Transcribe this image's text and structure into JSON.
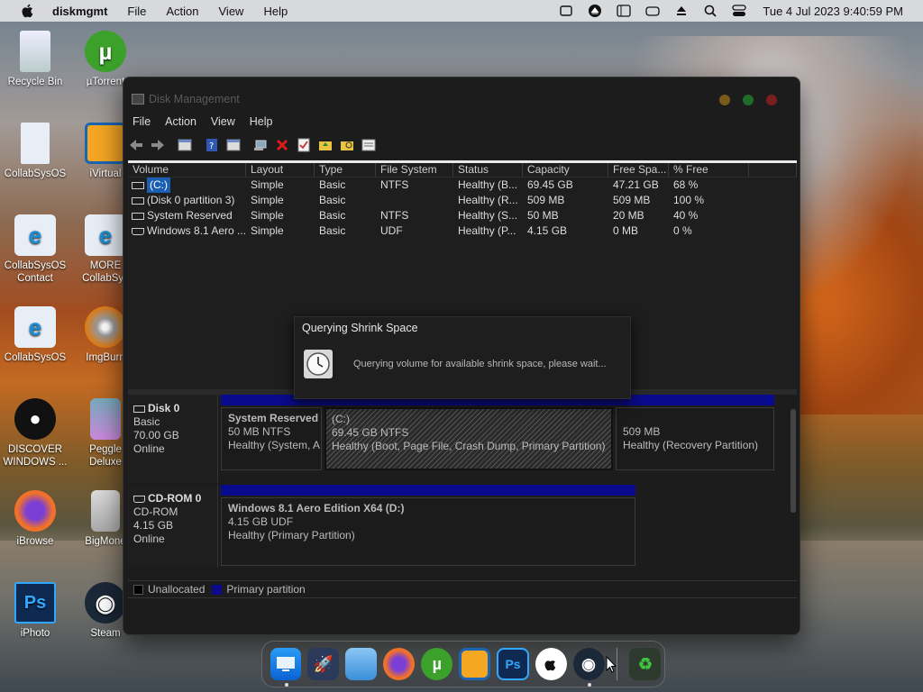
{
  "menubar": {
    "app_name": "diskmgmt",
    "items": [
      "File",
      "Action",
      "View",
      "Help"
    ],
    "clock": "Tue 4 Jul 2023  9:40:59 PM"
  },
  "desktop_icons": [
    {
      "label": "Recycle Bin",
      "icon": "recycle-bin-icon"
    },
    {
      "label": "µTorrent",
      "icon": "utorrent-icon"
    },
    {
      "label": "CollabSysOS",
      "icon": "document-icon"
    },
    {
      "label": "iVirtual",
      "icon": "virtualbox-icon"
    },
    {
      "label": "CollabSysOS\nContact",
      "icon": "ie-icon"
    },
    {
      "label": "MORE\nCollabSys",
      "icon": "ie-icon"
    },
    {
      "label": "CollabSysOS",
      "icon": "ie-icon"
    },
    {
      "label": "ImgBurn",
      "icon": "imgburn-icon"
    },
    {
      "label": "DISCOVER\nWINDOWS ...",
      "icon": "apple-icon"
    },
    {
      "label": "Peggle\nDeluxe",
      "icon": "peggle-icon"
    },
    {
      "label": "iBrowse",
      "icon": "firefox-icon"
    },
    {
      "label": "BigMone",
      "icon": "bigmoney-icon"
    },
    {
      "label": "iPhoto",
      "icon": "photoshop-icon"
    },
    {
      "label": "Steam",
      "icon": "steam-icon"
    }
  ],
  "window": {
    "title": "Disk Management",
    "menu": [
      "File",
      "Action",
      "View",
      "Help"
    ],
    "columns": [
      "Volume",
      "Layout",
      "Type",
      "File System",
      "Status",
      "Capacity",
      "Free Spa...",
      "% Free"
    ],
    "volumes": [
      {
        "volume": "(C:)",
        "layout": "Simple",
        "type": "Basic",
        "fs": "NTFS",
        "status": "Healthy (B...",
        "capacity": "69.45 GB",
        "free": "47.21 GB",
        "pct": "68 %"
      },
      {
        "volume": "(Disk 0 partition 3)",
        "layout": "Simple",
        "type": "Basic",
        "fs": "",
        "status": "Healthy (R...",
        "capacity": "509 MB",
        "free": "509 MB",
        "pct": "100 %"
      },
      {
        "volume": "System Reserved",
        "layout": "Simple",
        "type": "Basic",
        "fs": "NTFS",
        "status": "Healthy (S...",
        "capacity": "50 MB",
        "free": "20 MB",
        "pct": "40 %"
      },
      {
        "volume": "Windows 8.1 Aero ...",
        "layout": "Simple",
        "type": "Basic",
        "fs": "UDF",
        "status": "Healthy (P...",
        "capacity": "4.15 GB",
        "free": "0 MB",
        "pct": "0 %"
      }
    ],
    "dialog": {
      "title": "Querying Shrink Space",
      "message": "Querying volume for available shrink space, please wait..."
    },
    "disks": [
      {
        "name": "Disk 0",
        "kind": "Basic",
        "size": "70.00 GB",
        "state": "Online",
        "partitions": [
          {
            "name": "System Reserved",
            "line1": "50 MB NTFS",
            "line2": "Healthy (System, A"
          },
          {
            "name": "(C:)",
            "line1": "69.45 GB NTFS",
            "line2": "Healthy (Boot, Page File, Crash Dump, Primary Partition)"
          },
          {
            "name": "",
            "line1": "509 MB",
            "line2": "Healthy (Recovery Partition)"
          }
        ]
      },
      {
        "name": "CD-ROM 0",
        "kind": "CD-ROM",
        "size": "4.15 GB",
        "state": "Online",
        "partitions": [
          {
            "name": "Windows 8.1 Aero Edition X64  (D:)",
            "line1": "4.15 GB UDF",
            "line2": "Healthy (Primary Partition)"
          }
        ]
      }
    ],
    "legend": [
      "Unallocated",
      "Primary partition"
    ]
  },
  "colors": {
    "primary_partition": "#0a0a8c",
    "unallocated": "#000000",
    "selection": "#1a5fb4"
  },
  "dock": [
    "finder-icon",
    "launchpad-icon",
    "folder-icon",
    "firefox-icon",
    "utorrent-icon",
    "virtualbox-icon",
    "photoshop-icon",
    "apple-icon",
    "steam-icon",
    "trash-icon"
  ]
}
